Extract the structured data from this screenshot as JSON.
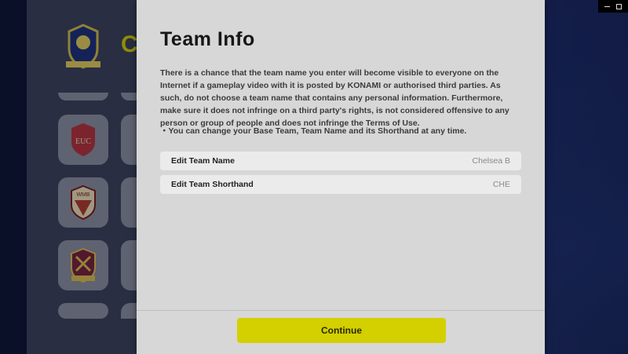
{
  "modal": {
    "title": "Team Info",
    "body": "There is a chance that the team name you enter will become visible to everyone on the Internet if a gameplay video with it is posted by KONAMI or authorised third parties. As such, do not choose a team name that contains any personal information. Furthermore, make sure it does not infringe on a third party's rights, is not considered offensive to any person or group of people and does not infringe the Terms of Use.",
    "note": "・You can change your Base Team, Team Name and its Shorthand at any time.",
    "fields": [
      {
        "label": "Edit Team Name",
        "value": "Chelsea B"
      },
      {
        "label": "Edit Team Shorthand",
        "value": "CHE"
      }
    ],
    "continue_label": "Continue"
  },
  "background": {
    "title_fragment": "C"
  },
  "colors": {
    "accent": "#d4d000",
    "modal_bg": "#d7d7d7",
    "background": "#1f2b63"
  }
}
